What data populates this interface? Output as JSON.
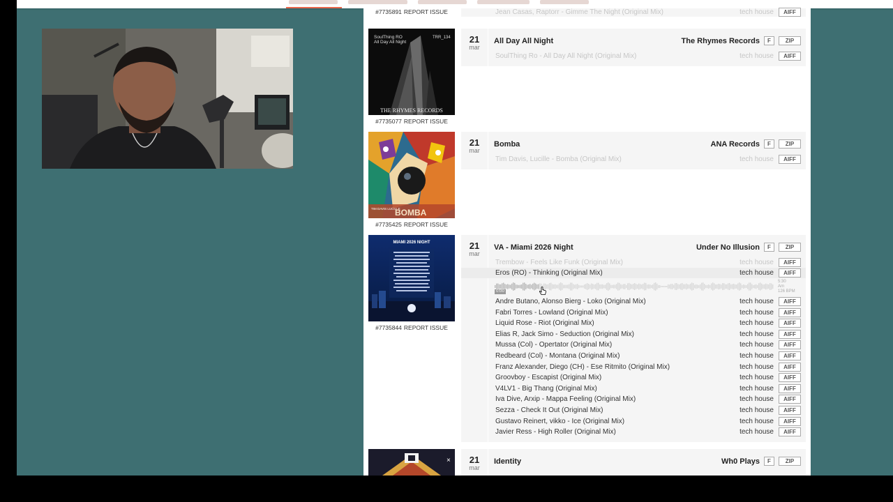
{
  "top_cutoff": {
    "catalog_id": "#7735891",
    "report_label": "REPORT ISSUE",
    "track": {
      "name": "Jean Casas, Raptorr - Gimme The Night (Original Mix)",
      "genre": "tech house",
      "format": "AIFF"
    }
  },
  "releases": [
    {
      "day": "21",
      "month": "mar",
      "title": "All Day All Night",
      "label": "The Rhymes Records",
      "f_label": "F",
      "zip_label": "ZIP",
      "catalog_id": "#7735077",
      "report_label": "REPORT ISSUE",
      "cover_text": {
        "artist": "SoulThing RO",
        "title": "All Day All Night",
        "code": "TRR_134",
        "footer": "THE RHYMES RECORDS"
      },
      "tracks": [
        {
          "name": "SoulThing Ro - All Day All Night (Original Mix)",
          "genre": "tech house",
          "format": "AIFF"
        }
      ]
    },
    {
      "day": "21",
      "month": "mar",
      "title": "Bomba",
      "label": "ANA Records",
      "f_label": "F",
      "zip_label": "ZIP",
      "catalog_id": "#7735425",
      "report_label": "REPORT ISSUE",
      "cover_text": {
        "artists": "TIM DAVIS LUCILLE",
        "title": "BOMBA"
      },
      "tracks": [
        {
          "name": "Tim Davis, Lucille - Bomba (Original Mix)",
          "genre": "tech house",
          "format": "AIFF"
        }
      ]
    },
    {
      "day": "21",
      "month": "mar",
      "title": "VA - Miami 2026 Night",
      "label": "Under No Illusion",
      "f_label": "F",
      "zip_label": "ZIP",
      "catalog_id": "#7735844",
      "report_label": "REPORT ISSUE",
      "cover_text": {
        "title": "MIAMI 2026 NIGHT"
      },
      "waveform": {
        "time": "0:00",
        "info": [
          "5:30",
          "Am",
          "126 BPM"
        ],
        "progress": 0.16
      },
      "tracks": [
        {
          "name": "Trembow - Feels Like Funk (Original Mix)",
          "genre": "tech house",
          "format": "AIFF"
        },
        {
          "name": "Eros (RO) - Thinking (Original Mix)",
          "genre": "tech house",
          "format": "AIFF"
        },
        {
          "name": "Andre Butano, Alonso Bierg - Loko (Original Mix)",
          "genre": "tech house",
          "format": "AIFF"
        },
        {
          "name": "Fabri Torres - Lowland (Original Mix)",
          "genre": "tech house",
          "format": "AIFF"
        },
        {
          "name": "Liquid Rose - Riot (Original Mix)",
          "genre": "tech house",
          "format": "AIFF"
        },
        {
          "name": "Elias R, Jack Simo - Seduction (Original Mix)",
          "genre": "tech house",
          "format": "AIFF"
        },
        {
          "name": "Mussa (Col) - Opertator (Original Mix)",
          "genre": "tech house",
          "format": "AIFF"
        },
        {
          "name": "Redbeard (Col) - Montana (Original Mix)",
          "genre": "tech house",
          "format": "AIFF"
        },
        {
          "name": "Franz Alexander, Diego (CH) - Ese Ritmito (Original Mix)",
          "genre": "tech house",
          "format": "AIFF"
        },
        {
          "name": "Groovboy - Escapist (Original Mix)",
          "genre": "tech house",
          "format": "AIFF"
        },
        {
          "name": "V4LV1 - Big Thang (Original Mix)",
          "genre": "tech house",
          "format": "AIFF"
        },
        {
          "name": "Iva Dive, Arxip - Mappa Feeling (Original Mix)",
          "genre": "tech house",
          "format": "AIFF"
        },
        {
          "name": "Sezza - Check It Out (Original Mix)",
          "genre": "tech house",
          "format": "AIFF"
        },
        {
          "name": "Gustavo Reinert, vikko - Ice (Original Mix)",
          "genre": "tech house",
          "format": "AIFF"
        },
        {
          "name": "Javier Ress - High Roller (Original Mix)",
          "genre": "tech house",
          "format": "AIFF"
        }
      ]
    },
    {
      "day": "21",
      "month": "mar",
      "title": "Identity",
      "label": "Wh0 Plays",
      "f_label": "F",
      "zip_label": "ZIP",
      "tracks": []
    }
  ],
  "colors": {
    "page_bg": "#3e6f72",
    "accent": "#e9674c",
    "panel": "#ffffff",
    "row_bg": "#f5f5f5"
  }
}
